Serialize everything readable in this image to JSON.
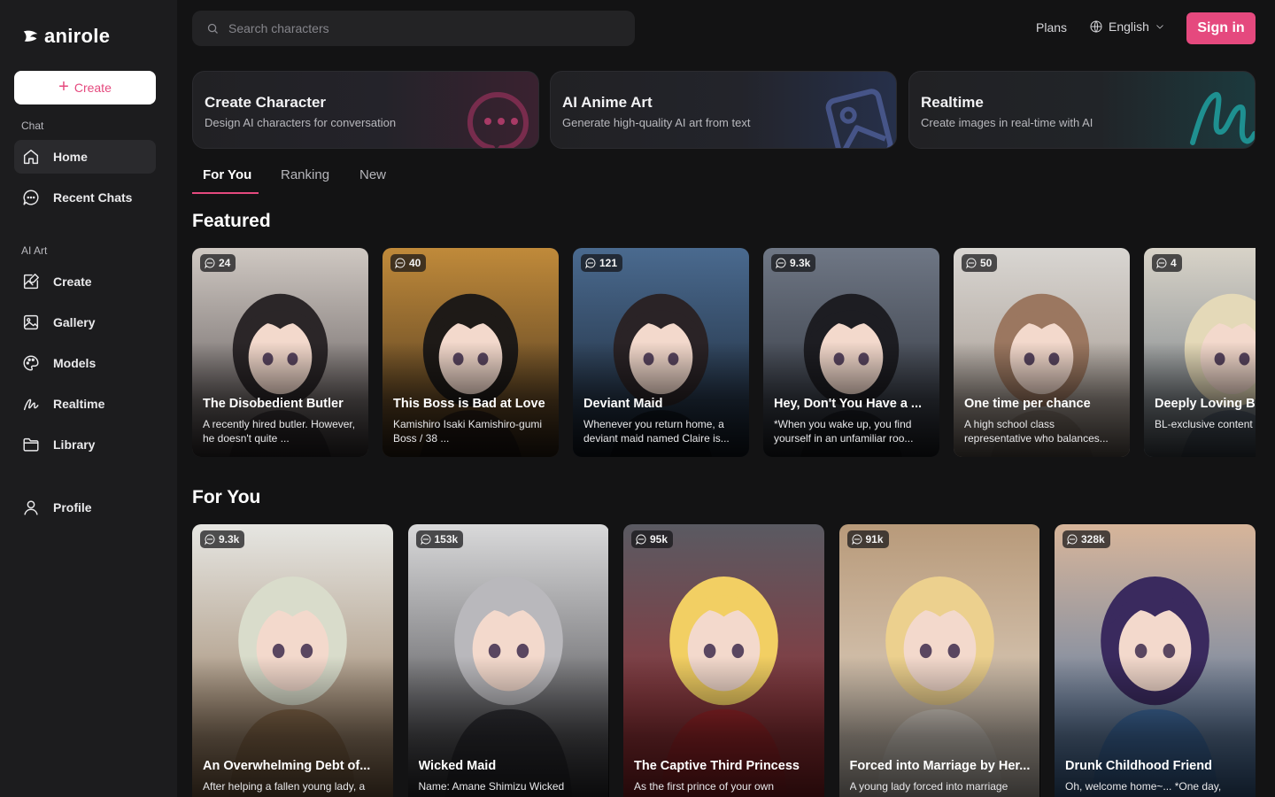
{
  "brand": {
    "name": "anirole",
    "accent": "#e5497e"
  },
  "sidebar": {
    "create_label": "Create",
    "sections": {
      "chat": "Chat",
      "ai_art": "AI Art"
    },
    "chat_items": [
      {
        "label": "Home",
        "icon": "home-icon"
      },
      {
        "label": "Recent Chats",
        "icon": "chat-bubble-icon"
      }
    ],
    "art_items": [
      {
        "label": "Create",
        "icon": "edit-image-icon"
      },
      {
        "label": "Gallery",
        "icon": "image-icon"
      },
      {
        "label": "Models",
        "icon": "palette-icon"
      },
      {
        "label": "Realtime",
        "icon": "scribble-icon"
      },
      {
        "label": "Library",
        "icon": "folder-icon"
      }
    ],
    "profile_label": "Profile"
  },
  "header": {
    "search_placeholder": "Search characters",
    "plans": "Plans",
    "language": "English",
    "sign_in": "Sign in"
  },
  "features": [
    {
      "title": "Create Character",
      "desc": "Design AI characters for conversation",
      "icon": "chat-dots-icon"
    },
    {
      "title": "AI Anime Art",
      "desc": "Generate high-quality AI art from text",
      "icon": "image-frame-icon"
    },
    {
      "title": "Realtime",
      "desc": "Create images in real-time with AI",
      "icon": "scribble-icon"
    }
  ],
  "tabs": [
    "For You",
    "Ranking",
    "New"
  ],
  "featured": {
    "heading": "Featured",
    "cards": [
      {
        "count": "24",
        "title": "The Disobedient Butler",
        "desc": "A recently hired butler. However, he doesn't quite ...",
        "c1": "#cfc8c2",
        "c2": "#3a3336",
        "hair": "#2b2628"
      },
      {
        "count": "40",
        "title": "This Boss is Bad at Love",
        "desc": "Kamishiro Isaki Kamishiro-gumi Boss / 38 ...",
        "c1": "#c08a3a",
        "c2": "#2a1f18",
        "hair": "#1e1a17"
      },
      {
        "count": "121",
        "title": "Deviant Maid",
        "desc": "Whenever you return home, a deviant maid named Claire is...",
        "c1": "#4a6a8f",
        "c2": "#10161f",
        "hair": "#2a2326"
      },
      {
        "count": "9.3k",
        "title": "Hey, Don't You Have a ...",
        "desc": "*When you wake up, you find yourself in an unfamiliar roo...",
        "c1": "#6f7785",
        "c2": "#1c1f26",
        "hair": "#1d1d22"
      },
      {
        "count": "50",
        "title": "One time per chance",
        "desc": "A high school class representative who balances...",
        "c1": "#d9d6d2",
        "c2": "#8e7f74",
        "hair": "#9b7760"
      },
      {
        "count": "4",
        "title": "Deeply Loving Bo",
        "desc": "BL-exclusive content enjoy~!...",
        "c1": "#d8d3c8",
        "c2": "#556270",
        "hair": "#e4d9b8"
      }
    ]
  },
  "foryou": {
    "heading": "For You",
    "cards": [
      {
        "count": "9.3k",
        "title": "An Overwhelming Debt of...",
        "desc": "After helping a fallen young lady, a",
        "c1": "#e6e6e2",
        "c2": "#8a6a4a",
        "hair": "#d9dccb"
      },
      {
        "count": "153k",
        "title": "Wicked Maid",
        "desc": "Name: Amane Shimizu Wicked",
        "c1": "#d9d9da",
        "c2": "#2e2e33",
        "hair": "#b9b8bc"
      },
      {
        "count": "95k",
        "title": "The Captive Third Princess",
        "desc": "As the first prince of your own",
        "c1": "#5a5a62",
        "c2": "#a2262a",
        "hair": "#f2cf63"
      },
      {
        "count": "91k",
        "title": "Forced into Marriage by Her...",
        "desc": "A young lady forced into marriage",
        "c1": "#b89a7a",
        "c2": "#e8e0d6",
        "hair": "#ecd08e"
      },
      {
        "count": "328k",
        "title": "Drunk Childhood Friend",
        "desc": "Oh, welcome home~... *One day,",
        "c1": "#d7b59a",
        "c2": "#3f6fa8",
        "hair": "#3a2a5e"
      }
    ]
  }
}
